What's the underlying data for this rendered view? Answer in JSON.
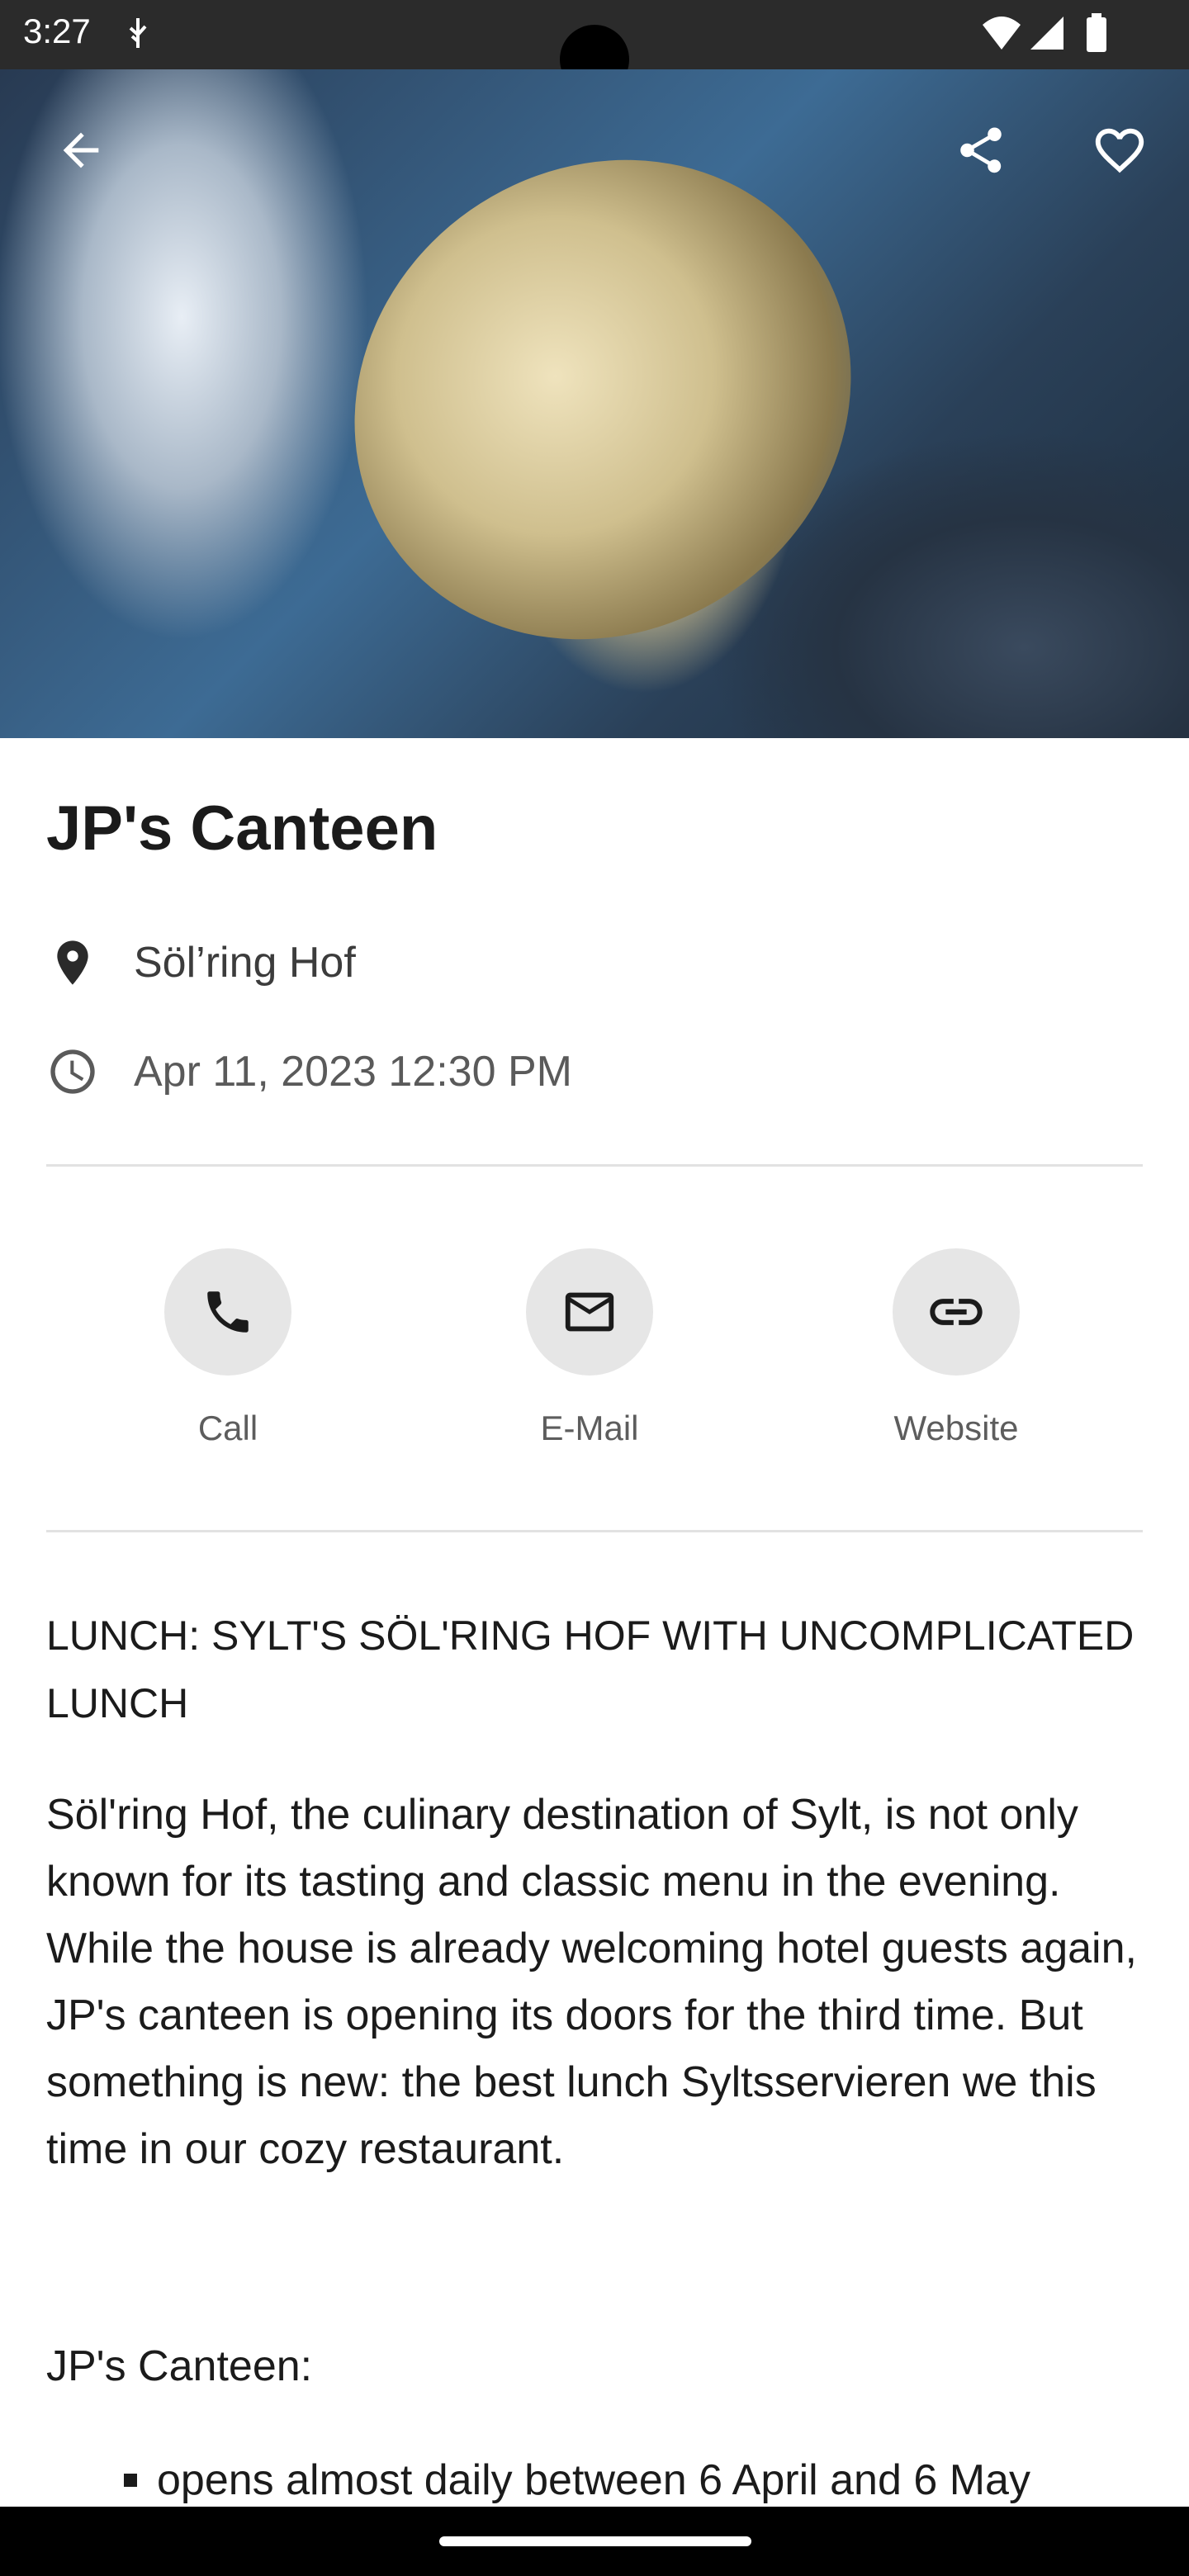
{
  "status_bar": {
    "time": "3:27"
  },
  "header": {
    "back_icon": "arrow-back-icon",
    "share_icon": "share-icon",
    "favorite_icon": "heart-outline-icon"
  },
  "event": {
    "title": "JP's Canteen",
    "location": "Söl’ring Hof",
    "datetime": "Apr 11, 2023 12:30 PM"
  },
  "actions": [
    {
      "label": "Call",
      "icon": "phone-icon"
    },
    {
      "label": "E-Mail",
      "icon": "mail-icon"
    },
    {
      "label": "Website",
      "icon": "link-icon"
    }
  ],
  "description": {
    "headline": "LUNCH: SYLT'S SÖL'RING HOF WITH UNCOMPLICATED LUNCH",
    "body": "Söl'ring Hof, the culinary destination of Sylt, is not only known for its tasting and classic menu in the evening. While the house is already welcoming hotel guests again, JP's canteen is opening its doors for the third time. But something is new: the best lunch Syltsservieren we this time in our cozy restaurant.",
    "subheading": "JP's Canteen:",
    "bullets": [
      "opens almost daily between 6 April and 6 May"
    ]
  },
  "colors": {
    "accent_circle": "#e6e6e6",
    "text": "#1b1b1b"
  }
}
